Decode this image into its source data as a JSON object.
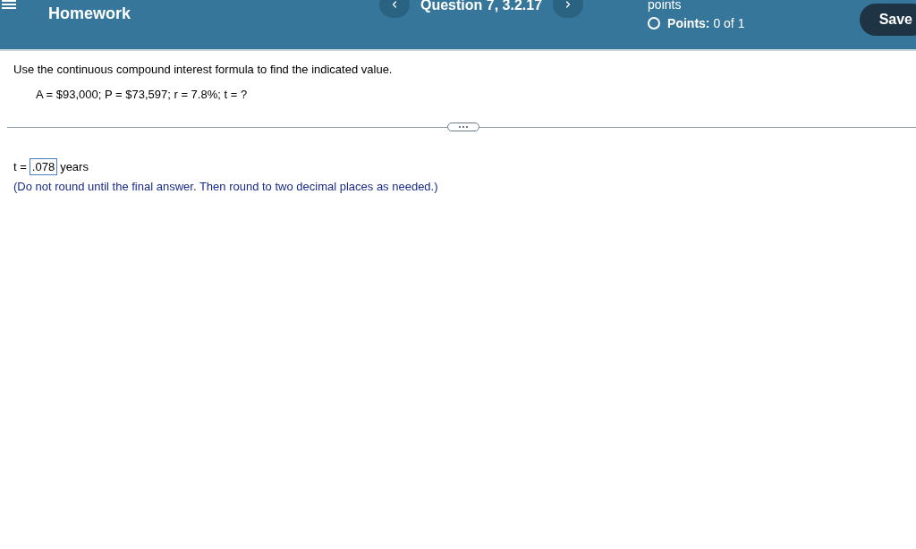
{
  "header": {
    "title": "Homework",
    "question": "Question 7, 3.2.17",
    "points_caption": "points",
    "points_label": "Points:",
    "points_value": "0 of 1",
    "answered": false,
    "save": "Save"
  },
  "question": {
    "instruction": "Use the continuous compound interest formula to find the indicated value.",
    "given": "A = $93,000; P = $73,597; r = 7.8%; t = ?"
  },
  "answer": {
    "prefix": "t =",
    "value": ".078",
    "unit": "years",
    "hint": "(Do not round until the final answer. Then round to two decimal places as needed.)"
  }
}
